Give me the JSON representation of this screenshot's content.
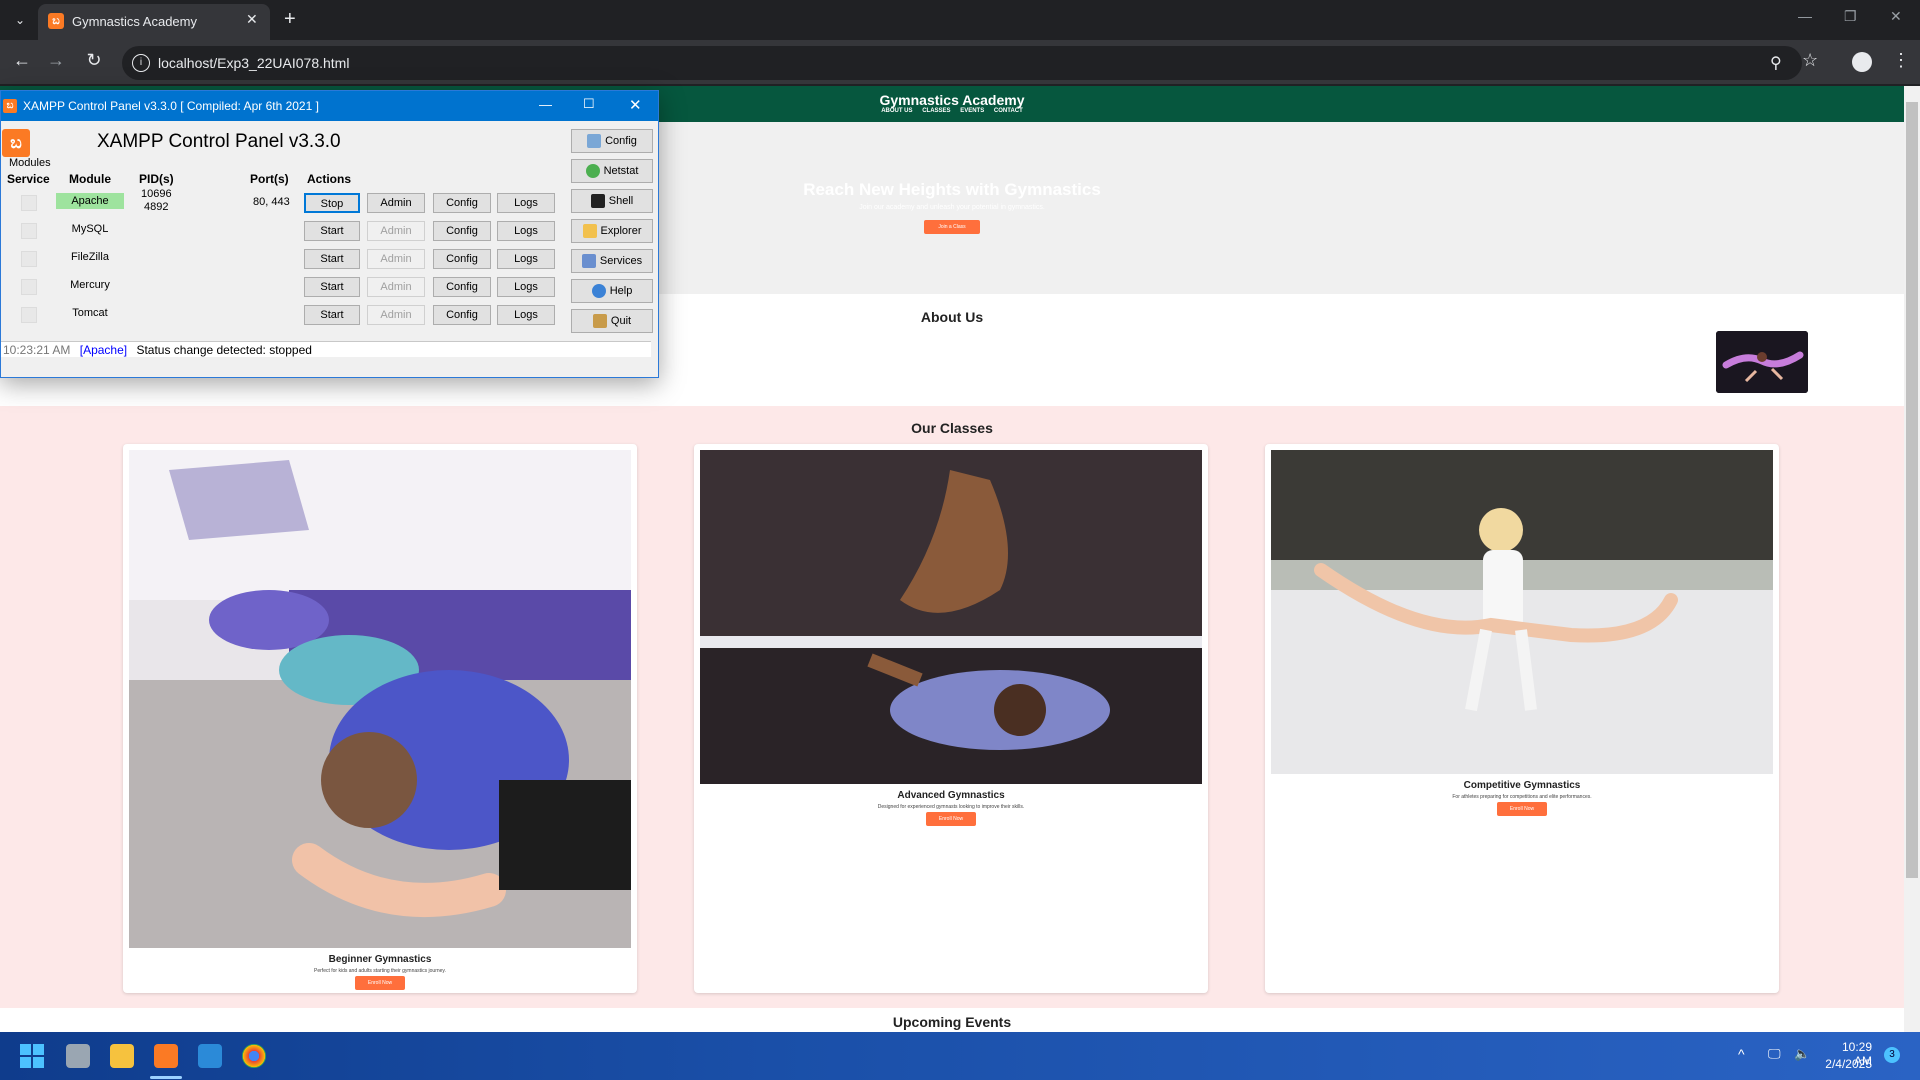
{
  "browser": {
    "tab_title": "Gymnastics Academy",
    "url": "localhost/Exp3_22UAI078.html",
    "new_tab": "+",
    "tab_close": "✕"
  },
  "site": {
    "title": "Gymnastics Academy",
    "nav": [
      "ABOUT US",
      "CLASSES",
      "EVENTS",
      "CONTACT"
    ],
    "hero_title": "Reach New Heights with Gymnastics",
    "hero_sub": "Join our academy and unleash your potential in gymnastics.",
    "hero_button": "Join a Class",
    "about_title": "About Us",
    "classes_title": "Our Classes",
    "classes": [
      {
        "title": "Beginner Gymnastics",
        "desc": "Perfect for kids and adults starting their gymnastics journey.",
        "button": "Enroll Now"
      },
      {
        "title": "Advanced Gymnastics",
        "desc": "Designed for experienced gymnasts looking to improve their skills.",
        "button": "Enroll Now"
      },
      {
        "title": "Competitive Gymnastics",
        "desc": "For athletes preparing for competitions and elite performances.",
        "button": "Enroll Now"
      }
    ],
    "events_title": "Upcoming Events"
  },
  "xampp": {
    "window_title": "XAMPP Control Panel v3.3.0   [ Compiled: Apr 6th 2021 ]",
    "heading": "XAMPP Control Panel v3.3.0",
    "modules_label": "Modules",
    "headers": {
      "service": "Service",
      "module": "Module",
      "pid": "PID(s)",
      "port": "Port(s)",
      "actions": "Actions"
    },
    "rows": [
      {
        "module": "Apache",
        "pid1": "10696",
        "pid2": "4892",
        "port": "80, 443",
        "start": "Stop",
        "admin": "Admin",
        "config": "Config",
        "logs": "Logs"
      },
      {
        "module": "MySQL",
        "pid1": "",
        "pid2": "",
        "port": "",
        "start": "Start",
        "admin": "Admin",
        "config": "Config",
        "logs": "Logs"
      },
      {
        "module": "FileZilla",
        "pid1": "",
        "pid2": "",
        "port": "",
        "start": "Start",
        "admin": "Admin",
        "config": "Config",
        "logs": "Logs"
      },
      {
        "module": "Mercury",
        "pid1": "",
        "pid2": "",
        "port": "",
        "start": "Start",
        "admin": "Admin",
        "config": "Config",
        "logs": "Logs"
      },
      {
        "module": "Tomcat",
        "pid1": "",
        "pid2": "",
        "port": "",
        "start": "Start",
        "admin": "Admin",
        "config": "Config",
        "logs": "Logs"
      }
    ],
    "side_buttons": [
      "Config",
      "Netstat",
      "Shell",
      "Explorer",
      "Services",
      "Help",
      "Quit"
    ],
    "log": {
      "time": "10:23:21 AM",
      "source": "[Apache]",
      "message": "Status change detected: stopped"
    }
  },
  "taskbar": {
    "time": "10:29 AM",
    "date": "2/4/2025",
    "notification_count": "3"
  },
  "colors": {
    "site_header": "#06573e",
    "accent_button": "#ff6f3c",
    "classes_bg": "#fde8e8",
    "xampp_titlebar": "#0073cf",
    "apache_running": "#9ee39e"
  }
}
